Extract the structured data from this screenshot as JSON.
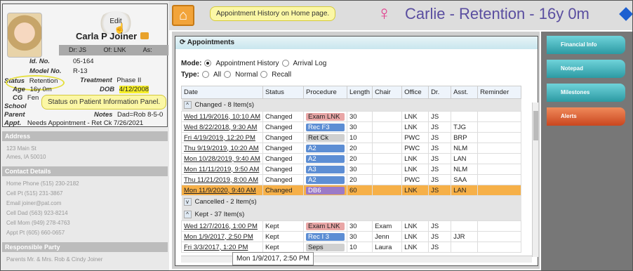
{
  "patient_panel": {
    "edit_label": "Edit",
    "name": "Carla P Joiner",
    "dr": "Dr: JS",
    "of": "Of: LNK",
    "as": "As:",
    "fields": [
      {
        "label": "Id. No.",
        "value": "05-164"
      },
      {
        "label": "Model No.",
        "value": "R-13"
      },
      {
        "label": "Status",
        "value": "Retention"
      },
      {
        "label": "Age",
        "value": "16y 0m"
      },
      {
        "label": "CG",
        "value": "Fen"
      },
      {
        "label": "School",
        "value": ""
      },
      {
        "label": "Parent",
        "value": ""
      },
      {
        "label": "Appt.",
        "value": "Needs Appointment - Ret Ck 7/26/2021"
      }
    ],
    "treatment_label": "Treatment",
    "treatment_value": "Phase II",
    "dob_label": "DOB",
    "dob_value": "4/12/2008",
    "notes_label": "Notes",
    "notes_value": "Dad=Rob 8-5-0"
  },
  "callouts": {
    "status": "Status on Patient Information Panel.",
    "appointment": "Appointment History on Home page."
  },
  "left_sections": {
    "address": "Address",
    "address_lines": [
      "123 Main St",
      "Ames, IA 50010"
    ],
    "contact": "Contact Details",
    "contact_lines": [
      "Home Phone  (515) 230-2182",
      "Cell Pt  (515) 231-3867",
      "Email  joiner@pat.com",
      "Cell Dad  (563) 923-8214",
      "Cell Mom  (949) 278-4763",
      "Appt Pt  (605) 660-0657"
    ],
    "responsible": "Responsible Party",
    "parents": "Parents  Mr. & Mrs. Rob & Cindy Joiner"
  },
  "header": {
    "title": "Carlie - Retention - 16y 0m"
  },
  "right_buttons": [
    "Financial Info",
    "Notepad",
    "Milestones",
    "Alerts"
  ],
  "appointments": {
    "title": "Appointments",
    "mode_label": "Mode:",
    "mode_options": [
      "Appointment History",
      "Arrival Log"
    ],
    "type_label": "Type:",
    "type_options": [
      "All",
      "Normal",
      "Recall"
    ],
    "columns": [
      "Date",
      "Status",
      "Procedure",
      "Length",
      "Chair",
      "Office",
      "Dr.",
      "Asst.",
      "Reminder"
    ],
    "groups": [
      {
        "label": "Changed - 8 Item(s)",
        "toggle": "^",
        "rows": [
          {
            "date": "Wed 11/9/2016, 10:10 AM",
            "status": "Changed",
            "procedure": "Exam LNK",
            "pcolor": "#e9a6a6",
            "length": "30",
            "chair": "",
            "office": "LNK",
            "dr": "JS",
            "asst": "",
            "reminder": ""
          },
          {
            "date": "Wed 8/22/2018, 9:30 AM",
            "status": "Changed",
            "procedure": "Rec F3",
            "pcolor": "#5d8ed4",
            "length": "30",
            "chair": "",
            "office": "LNK",
            "dr": "JS",
            "asst": "TJG",
            "reminder": ""
          },
          {
            "date": "Fri 4/19/2019, 12:20 PM",
            "status": "Changed",
            "procedure": "Ret Ck",
            "pcolor": "#d0d0d0",
            "length": "10",
            "chair": "",
            "office": "PWC",
            "dr": "JS",
            "asst": "BRP",
            "reminder": ""
          },
          {
            "date": "Thu 9/19/2019, 10:20 AM",
            "status": "Changed",
            "procedure": "A2",
            "pcolor": "#5d8ed4",
            "length": "20",
            "chair": "",
            "office": "PWC",
            "dr": "JS",
            "asst": "NLM",
            "reminder": ""
          },
          {
            "date": "Mon 10/28/2019, 9:40 AM",
            "status": "Changed",
            "procedure": "A2",
            "pcolor": "#5d8ed4",
            "length": "20",
            "chair": "",
            "office": "LNK",
            "dr": "JS",
            "asst": "LAN",
            "reminder": ""
          },
          {
            "date": "Mon 11/11/2019, 9:50 AM",
            "status": "Changed",
            "procedure": "A3",
            "pcolor": "#5d8ed4",
            "length": "30",
            "chair": "",
            "office": "LNK",
            "dr": "JS",
            "asst": "NLM",
            "reminder": ""
          },
          {
            "date": "Thu 11/21/2019, 8:00 AM",
            "status": "Changed",
            "procedure": "A2",
            "pcolor": "#5d8ed4",
            "length": "20",
            "chair": "",
            "office": "PWC",
            "dr": "JS",
            "asst": "SAA",
            "reminder": ""
          },
          {
            "date": "Mon 11/9/2020, 9:40 AM",
            "status": "Changed",
            "procedure": "DB6",
            "pcolor": "#9b7ac7",
            "length": "60",
            "chair": "",
            "office": "LNK",
            "dr": "JS",
            "asst": "LAN",
            "reminder": "",
            "selected": true
          }
        ]
      },
      {
        "label": "Cancelled - 2 Item(s)",
        "toggle": "v",
        "rows": []
      },
      {
        "label": "Kept - 37 Item(s)",
        "toggle": "^",
        "rows": [
          {
            "date": "Wed 12/7/2016, 1:00 PM",
            "status": "Kept",
            "procedure": "Exam LNK",
            "pcolor": "#e9a6a6",
            "length": "30",
            "chair": "Exam",
            "office": "LNK",
            "dr": "JS",
            "asst": "",
            "reminder": ""
          },
          {
            "date": "Mon 1/9/2017, 2:50 PM",
            "status": "Kept",
            "procedure": "Rec I 3",
            "pcolor": "#5d8ed4",
            "length": "30",
            "chair": "Jenn",
            "office": "LNK",
            "dr": "JS",
            "asst": "JJR",
            "reminder": ""
          },
          {
            "date": "Fri 3/3/2017, 1:20 PM",
            "status": "Kept",
            "procedure": "Seps",
            "pcolor": "#d0d0d0",
            "length": "10",
            "chair": "Laura",
            "office": "LNK",
            "dr": "JS",
            "asst": "",
            "reminder": ""
          }
        ]
      }
    ],
    "tooltip": "Mon 1/9/2017, 2:50 PM"
  }
}
